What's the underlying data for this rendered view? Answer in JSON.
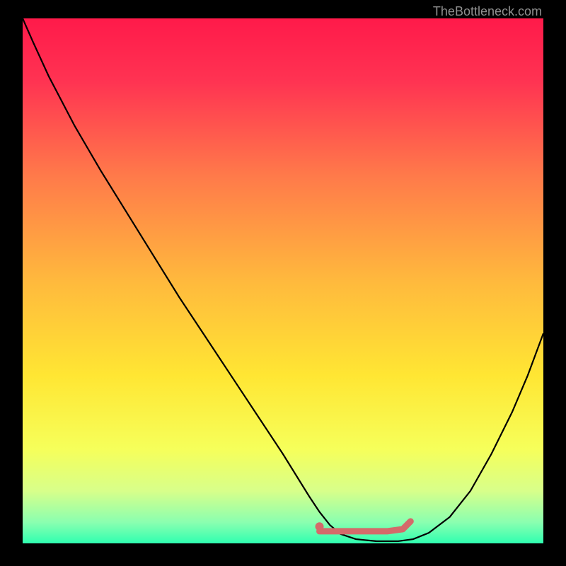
{
  "attribution": "TheBottleneck.com",
  "chart_data": {
    "type": "line",
    "title": "",
    "xlabel": "",
    "ylabel": "",
    "xlim": [
      0,
      100
    ],
    "ylim": [
      0,
      100
    ],
    "background_gradient": {
      "stops": [
        {
          "offset": 0,
          "color": "#ff1a4a"
        },
        {
          "offset": 0.12,
          "color": "#ff3352"
        },
        {
          "offset": 0.3,
          "color": "#ff7a4a"
        },
        {
          "offset": 0.5,
          "color": "#ffb93d"
        },
        {
          "offset": 0.68,
          "color": "#ffe633"
        },
        {
          "offset": 0.82,
          "color": "#f6ff5a"
        },
        {
          "offset": 0.9,
          "color": "#d8ff8a"
        },
        {
          "offset": 0.96,
          "color": "#8affb0"
        },
        {
          "offset": 1.0,
          "color": "#2fffb0"
        }
      ]
    },
    "curve": {
      "x": [
        0.0,
        2.0,
        5.0,
        10.0,
        15.0,
        20.0,
        25.0,
        30.0,
        35.0,
        40.0,
        45.0,
        50.0,
        55.0,
        57.0,
        59.0,
        61.0,
        64.0,
        68.0,
        72.0,
        75.0,
        78.0,
        82.0,
        86.0,
        90.0,
        94.0,
        97.0,
        100.0
      ],
      "y": [
        100.0,
        95.5,
        89.0,
        79.5,
        71.0,
        63.0,
        55.0,
        47.0,
        39.5,
        32.0,
        24.5,
        17.0,
        9.0,
        6.0,
        3.5,
        1.8,
        0.8,
        0.4,
        0.4,
        0.8,
        2.0,
        5.0,
        10.0,
        17.0,
        25.0,
        32.0,
        40.0
      ]
    },
    "highlight_segment": {
      "color": "#d46a6a",
      "x": [
        57.0,
        59.0,
        62.0,
        66.0,
        70.0,
        73.0,
        74.5
      ],
      "y": [
        2.3,
        2.3,
        2.3,
        2.3,
        2.3,
        2.7,
        4.2
      ]
    },
    "highlight_dot": {
      "x": 57.0,
      "y": 3.2,
      "color": "#d46a6a"
    }
  }
}
